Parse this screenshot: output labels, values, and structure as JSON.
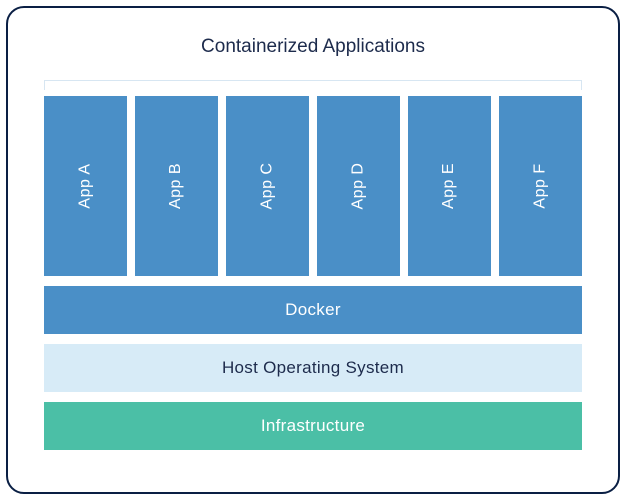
{
  "title": "Containerized Applications",
  "apps": {
    "0": "App A",
    "1": "App B",
    "2": "App C",
    "3": "App D",
    "4": "App E",
    "5": "App F"
  },
  "layers": {
    "docker": "Docker",
    "host_os": "Host Operating System",
    "infrastructure": "Infrastructure"
  }
}
